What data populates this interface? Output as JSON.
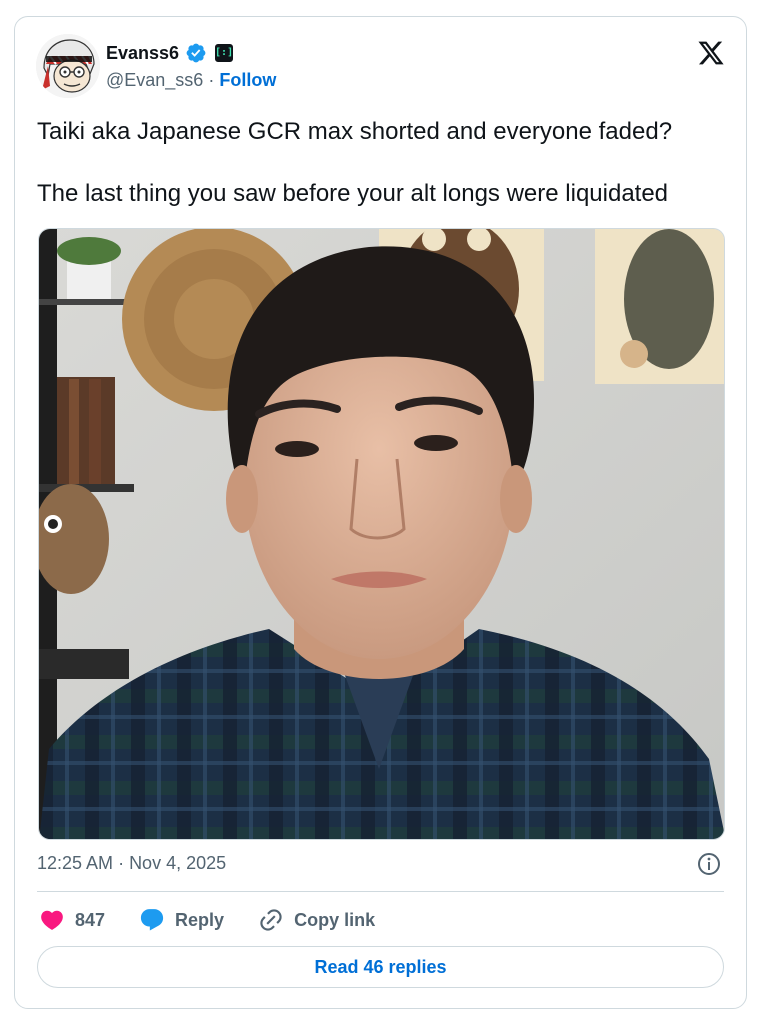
{
  "author": {
    "display_name": "Evanss6",
    "handle": "@Evan_ss6",
    "separator": "·",
    "follow_label": "Follow",
    "avatar_icon": "cartoon-avatar-keffiyeh",
    "verified_icon": "verified-badge-icon",
    "affiliate_icon": "affiliate-badge-icon"
  },
  "platform": {
    "logo_icon": "x-logo-icon"
  },
  "tweet": {
    "lines": [
      "Taiki aka Japanese GCR max shorted and everyone faded?",
      "The last thing you saw before your alt longs were liquidated"
    ],
    "media_icon": "photo-of-man-in-plaid-shirt"
  },
  "meta": {
    "time": "12:25 AM",
    "separator": "·",
    "date": "Nov 4, 2025",
    "info_icon": "info-icon"
  },
  "actions": {
    "like_count": "847",
    "reply_label": "Reply",
    "copy_link_label": "Copy link"
  },
  "footer": {
    "read_replies_label": "Read 46 replies"
  },
  "colors": {
    "accent_blue": "#006fd6",
    "heart_pink": "#f91880",
    "muted_text": "#536471",
    "border": "#cfd9de",
    "verified_blue": "#1d9bf0"
  }
}
